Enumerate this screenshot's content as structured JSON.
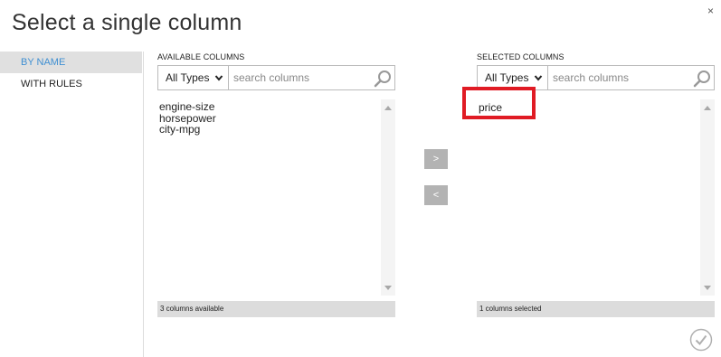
{
  "dialog": {
    "title": "Select a single column",
    "close_label": "×"
  },
  "sidebar": {
    "items": [
      {
        "label": "BY NAME",
        "active": true
      },
      {
        "label": "WITH RULES",
        "active": false
      }
    ]
  },
  "available": {
    "header": "AVAILABLE COLUMNS",
    "type_filter": "All Types",
    "search_placeholder": "search columns",
    "items": [
      "engine-size",
      "horsepower",
      "city-mpg"
    ],
    "status": "3 columns available"
  },
  "selected": {
    "header": "SELECTED COLUMNS",
    "type_filter": "All Types",
    "search_placeholder": "search columns",
    "items": [
      "price"
    ],
    "status": "1 columns selected"
  },
  "actions": {
    "add_label": ">",
    "remove_label": "<"
  },
  "icons": {
    "search": "search-icon",
    "chevron": "chevron-down-icon",
    "ok": "checkmark-circle-icon"
  },
  "colors": {
    "accent": "#3f8fd2",
    "highlight": "#e01b24",
    "button": "#b3b3b3",
    "status_bar": "#dcdcdc"
  }
}
